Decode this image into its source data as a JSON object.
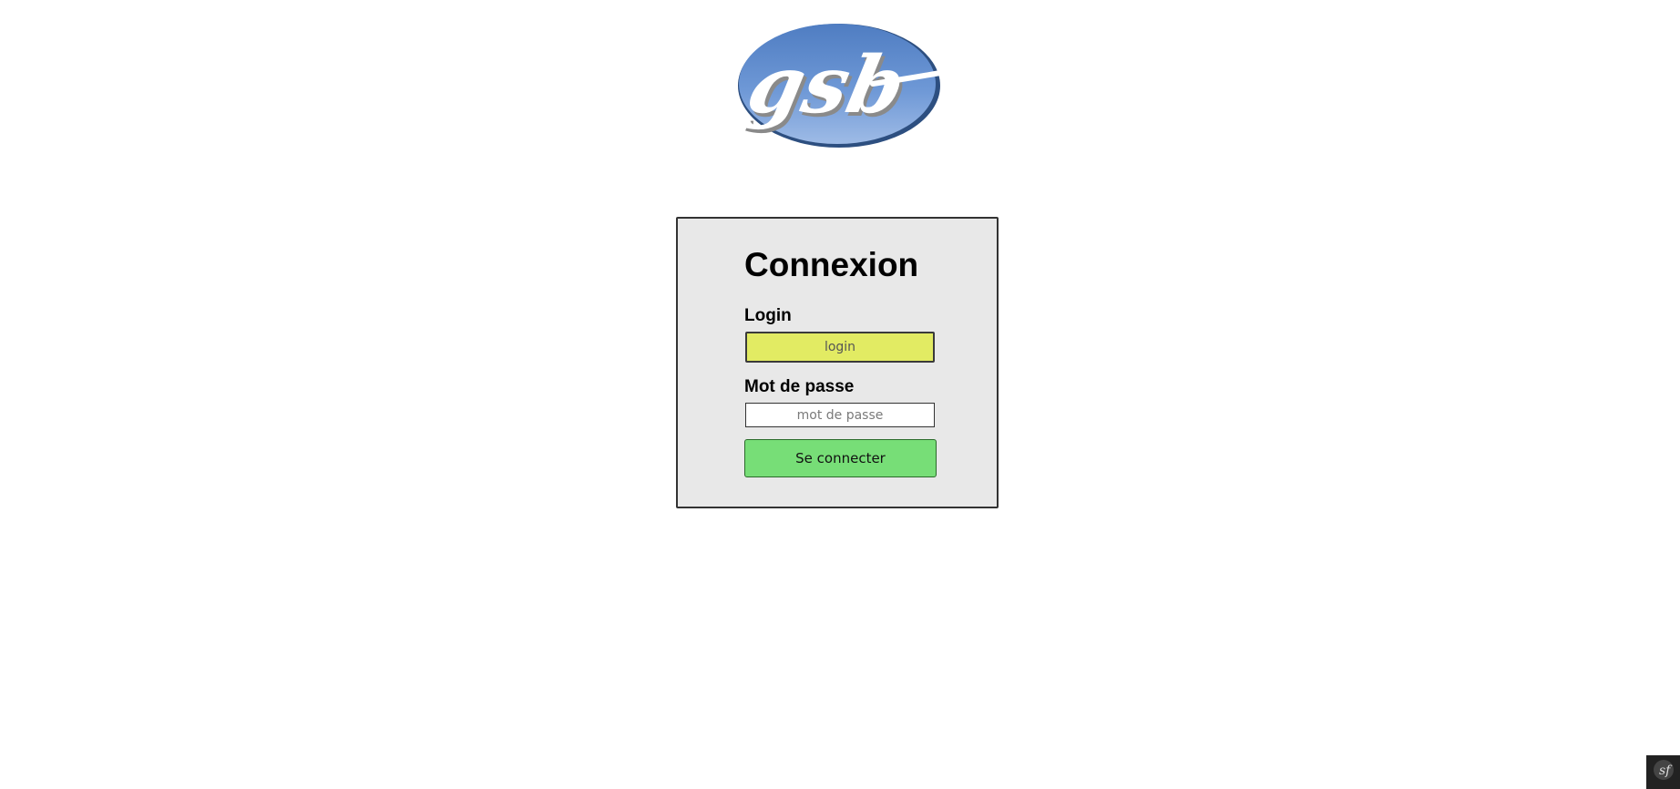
{
  "logo": {
    "text": "gsb",
    "colors": {
      "oval": "#5a86c8",
      "oval_dark": "#2d5596",
      "letters": "#ffffff"
    }
  },
  "login_form": {
    "title": "Connexion",
    "login_label": "Login",
    "login_placeholder": "login",
    "password_label": "Mot de passe",
    "password_placeholder": "mot de passe",
    "submit_label": "Se connecter"
  },
  "colors": {
    "panel_background": "#e8e8e8",
    "login_input_focus": "#e2eb63",
    "submit_button": "#77de77"
  },
  "debug_toolbar": {
    "icon": "symfony-logo-icon"
  }
}
